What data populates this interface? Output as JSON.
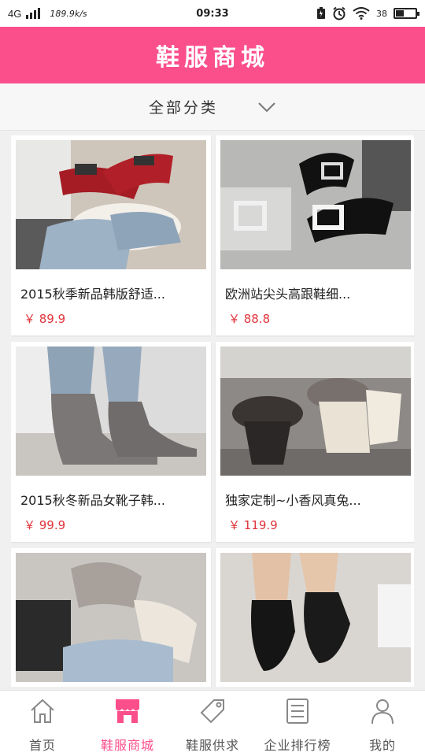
{
  "status_bar": {
    "network": "4G",
    "speed": "189.9k/s",
    "time": "09:33",
    "battery": "38",
    "battery_fraction": 0.38,
    "icons": [
      "signal-icon",
      "battery-saver-icon",
      "alarm-icon",
      "wifi-icon",
      "battery-icon"
    ]
  },
  "header": {
    "title": "鞋服商城"
  },
  "category": {
    "label": "全部分类",
    "icon": "chevron-down-icon"
  },
  "products": [
    {
      "name": "2015秋季新品韩版舒适...",
      "price": "￥ 89.9",
      "image": "red-flats-photo"
    },
    {
      "name": "欧洲站尖头高跟鞋细...",
      "price": "￥ 88.8",
      "image": "black-heels-photo"
    },
    {
      "name": "2015秋冬新品女靴子韩...",
      "price": "￥ 99.9",
      "image": "grey-boots-photo"
    },
    {
      "name": "独家定制~小香风真兔...",
      "price": "￥ 119.9",
      "image": "fur-boots-photo"
    },
    {
      "name": "",
      "price": "",
      "image": "beige-heels-photo"
    },
    {
      "name": "",
      "price": "",
      "image": "black-booties-photo"
    }
  ],
  "tabs": [
    {
      "label": "首页",
      "icon": "home-icon",
      "active": false
    },
    {
      "label": "鞋服商城",
      "icon": "store-icon",
      "active": true
    },
    {
      "label": "鞋服供求",
      "icon": "tag-icon",
      "active": false
    },
    {
      "label": "企业排行榜",
      "icon": "list-icon",
      "active": false
    },
    {
      "label": "我的",
      "icon": "user-icon",
      "active": false
    }
  ],
  "colors": {
    "accent": "#fb4f8c",
    "price": "#e0343b",
    "tab_inactive": "#888888"
  }
}
